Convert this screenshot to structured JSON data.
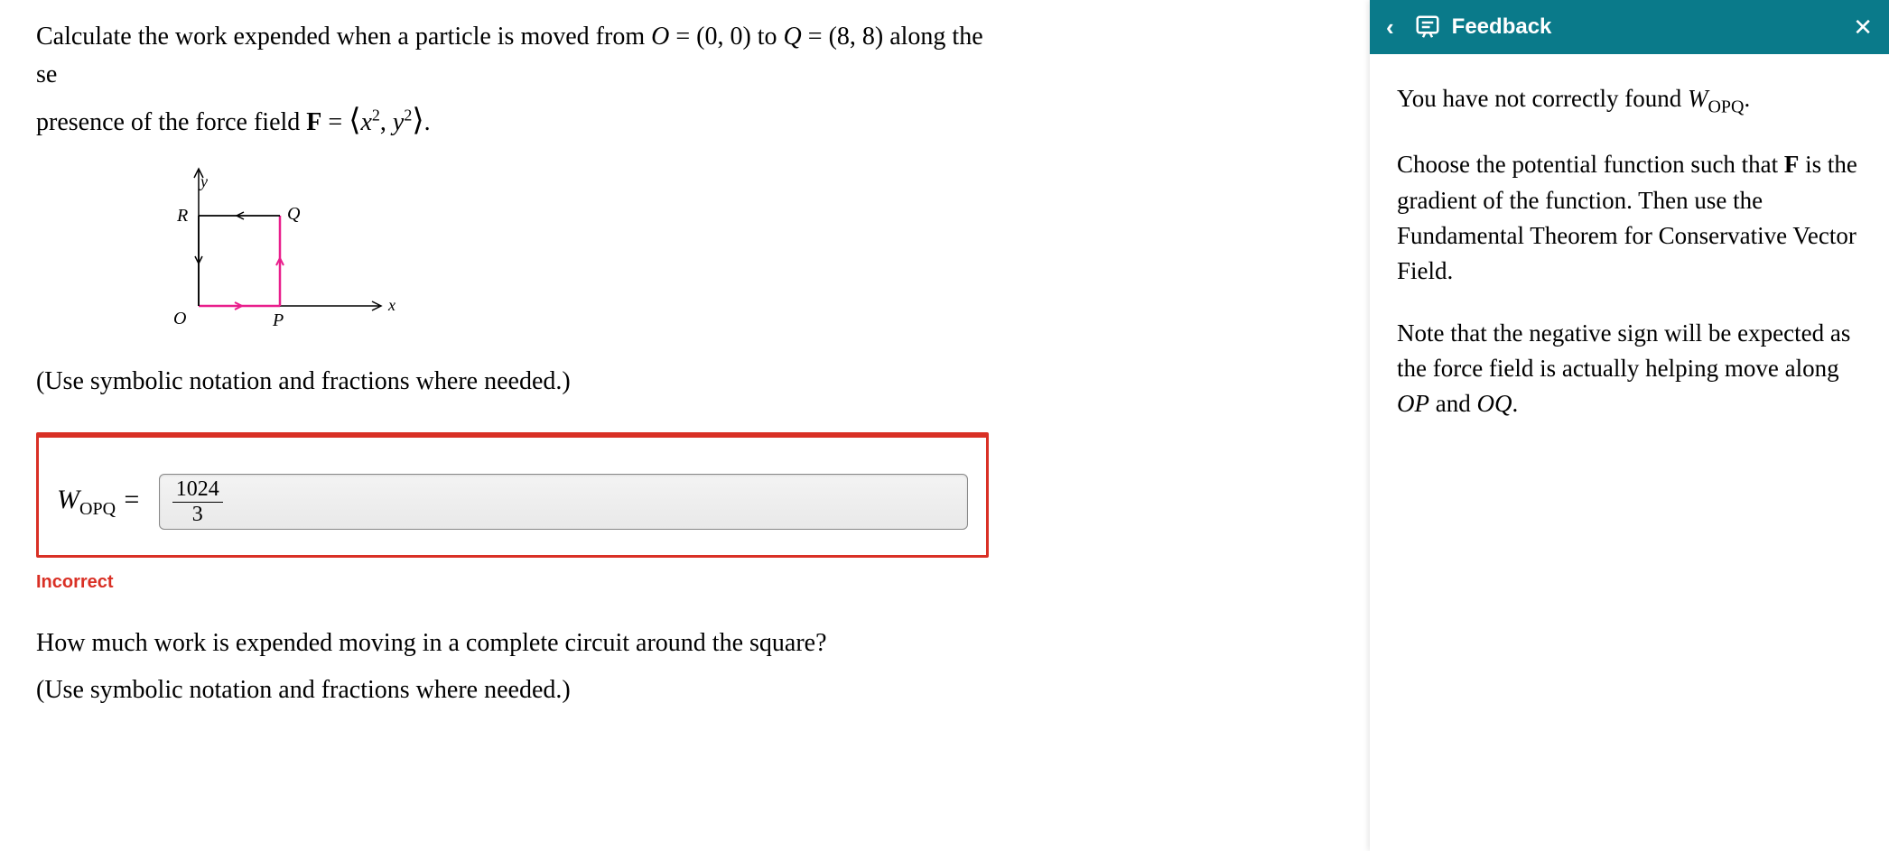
{
  "prompt": {
    "line1_a": "Calculate the work expended when a particle is moved from ",
    "O": "O",
    "eq1": " = (0, 0) to ",
    "Q": "Q",
    "eq2": " = (8, 8) along the se",
    "line2_a": "presence of the force field ",
    "F": "F",
    "eq3": " = ",
    "vec_open": "⟨",
    "vec_x": "x",
    "vec_sq1": "2",
    "vec_comma": ", ",
    "vec_y": "y",
    "vec_sq2": "2",
    "vec_close": "⟩",
    "period": "."
  },
  "graph": {
    "labelR": "R",
    "labelQ": "Q",
    "labelO": "O",
    "labelP": "P",
    "labelX": "x",
    "labelY": "y"
  },
  "instruction1": "(Use symbolic notation and fractions where needed.)",
  "answer": {
    "labelW": "W",
    "labelSub": "OPQ",
    "labelEq": " = ",
    "value_num": "1024",
    "value_den": "3"
  },
  "incorrect": "Incorrect",
  "question2": {
    "line1": "How much work is expended moving in a complete circuit around the square?",
    "line2": "(Use symbolic notation and fractions where needed.)"
  },
  "feedback": {
    "title": "Feedback",
    "p1_a": "You have not correctly found ",
    "p1_W": "W",
    "p1_sub": "OPQ",
    "p1_end": ".",
    "p2_a": "Choose the potential function such that ",
    "p2_F": "F",
    "p2_b": " is the gradient of the function. Then use the Fundamental Theorem for Conservative Vector Field.",
    "p3_a": "Note that the negative sign will be expected as the force field is actually helping move along ",
    "p3_OP": "OP",
    "p3_and": " and ",
    "p3_OQ": "OQ",
    "p3_end": "."
  }
}
